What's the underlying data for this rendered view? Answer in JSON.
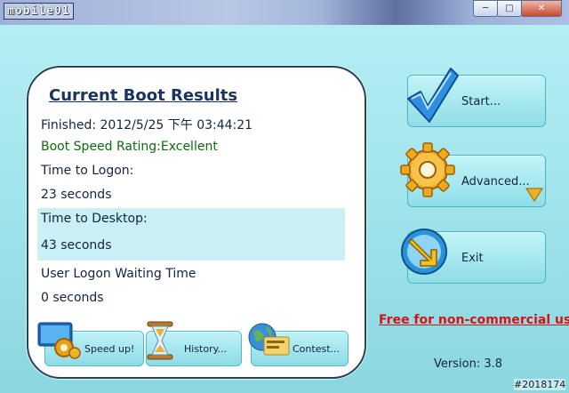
{
  "window": {
    "logo": "mobile01",
    "minimize_icon": "minimize-icon",
    "maximize_icon": "maximize-icon",
    "close_icon": "close-icon"
  },
  "results": {
    "heading": "Current Boot Results",
    "finished": "Finished: 2012/5/25 下午 03:44:21",
    "rating": "Boot Speed Rating:Excellent",
    "logon_label": "Time to Logon:",
    "logon_value": "23 seconds",
    "desktop_label": "Time to Desktop:",
    "desktop_value": "43 seconds",
    "waiting_label": "User Logon Waiting Time",
    "waiting_value": "0 seconds"
  },
  "panel_buttons": {
    "speedup": "Speed up!",
    "history": "History...",
    "contest": "Contest..."
  },
  "side_buttons": {
    "start": "Start...",
    "advanced": "Advanced...",
    "exit": "Exit"
  },
  "footer": {
    "free": "Free for non-commercial use",
    "version": "Version: 3.8",
    "watermark": "#2018174"
  },
  "colors": {
    "background": "#9fe2ea",
    "rating_green": "#0d6b0d",
    "free_red": "#d41414"
  }
}
